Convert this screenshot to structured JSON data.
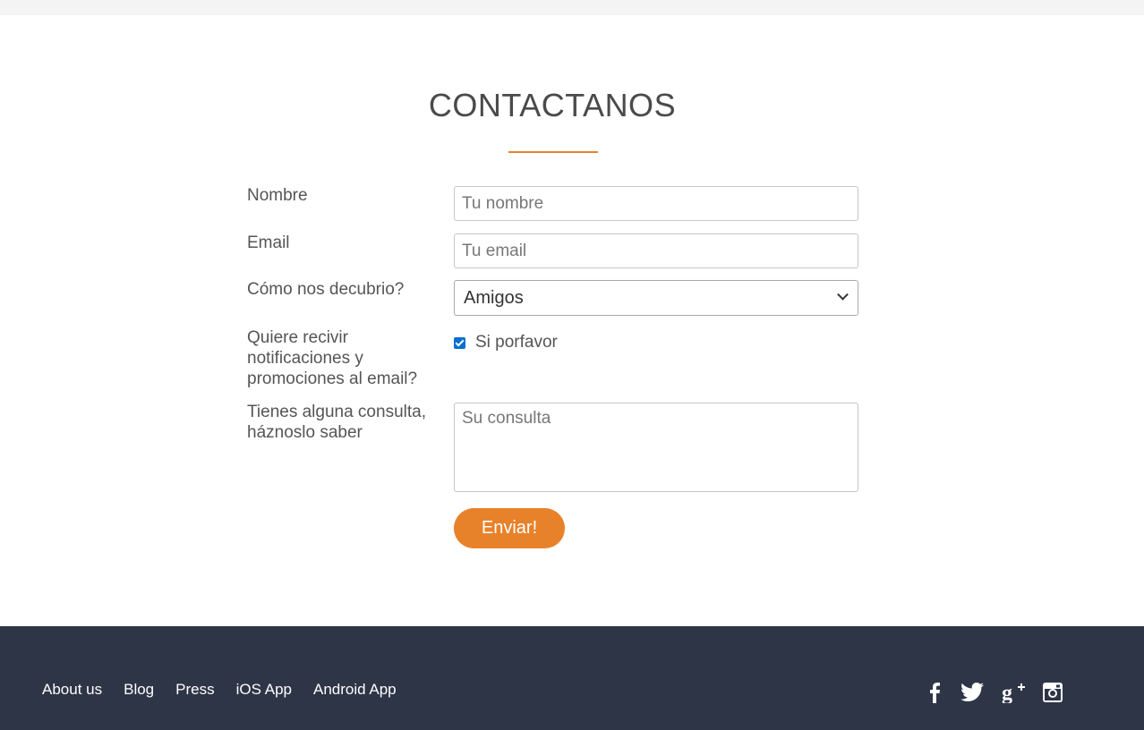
{
  "section": {
    "title": "CONTACTANOS",
    "accent_color": "#e8822a"
  },
  "form": {
    "name": {
      "label": "Nombre",
      "placeholder": "Tu nombre",
      "value": ""
    },
    "email": {
      "label": "Email",
      "placeholder": "Tu email",
      "value": ""
    },
    "source": {
      "label": "Cómo nos decubrio?",
      "selected": "Amigos"
    },
    "notifications": {
      "label": "Quiere recivir notificaciones y promociones al email?",
      "checkbox_label": "Si porfavor",
      "checked": true
    },
    "query": {
      "label": "Tienes alguna consulta, háznoslo saber",
      "placeholder": "Su consulta",
      "value": ""
    },
    "submit_label": "Enviar!"
  },
  "footer": {
    "background": "#2e3547",
    "links": [
      "About us",
      "Blog",
      "Press",
      "iOS App",
      "Android App"
    ],
    "social_icons": [
      "facebook-icon",
      "twitter-icon",
      "google-plus-icon",
      "instagram-icon"
    ]
  }
}
